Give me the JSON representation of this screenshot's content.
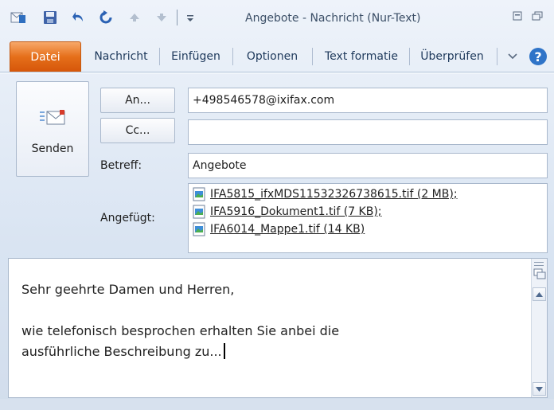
{
  "window": {
    "title": "Angebote - Nachricht (Nur-Text)"
  },
  "quick_access": [
    "outlook-icon",
    "save-icon",
    "undo-icon",
    "redo-icon",
    "up-arrow-icon",
    "down-arrow-icon",
    "customize-icon"
  ],
  "tabs": [
    {
      "label": "Datei",
      "active": true
    },
    {
      "label": "Nachricht"
    },
    {
      "label": "Einfügen"
    },
    {
      "label": "Optionen"
    },
    {
      "label": "Text formatie"
    },
    {
      "label": "Überprüfen"
    }
  ],
  "header": {
    "send_label": "Senden",
    "to_button": "An...",
    "cc_button": "Cc...",
    "to_value": "+498546578@ixifax.com",
    "cc_value": "",
    "subject_label": "Betreff:",
    "subject_value": "Angebote",
    "attached_label": "Angefügt:",
    "attachments": [
      "IFA5815_ifxMDS11532326738615.tif (2 MB);",
      "IFA5916_Dokument1.tif (7 KB);",
      "IFA6014_Mappe1.tif (14 KB)"
    ]
  },
  "body": {
    "lines": [
      "Sehr geehrte Damen und Herren,",
      "",
      "wie telefonisch besprochen erhalten Sie anbei die",
      "ausführliche Beschreibung zu..."
    ]
  },
  "colors": {
    "file_tab": "#e56f1a",
    "ribbon": "#d9e4f2",
    "link": "#1e1e1e"
  }
}
